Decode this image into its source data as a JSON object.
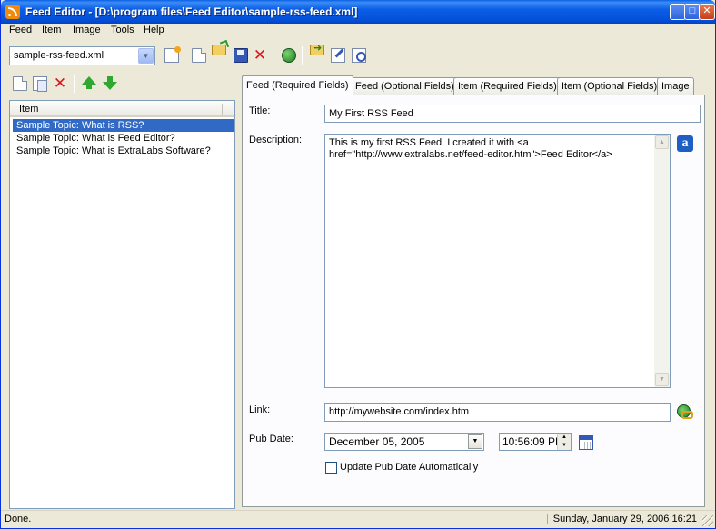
{
  "window": {
    "title": "Feed Editor - [D:\\program files\\Feed Editor\\sample-rss-feed.xml]",
    "minimize": "_",
    "maximize": "□",
    "close": "✕"
  },
  "menu": [
    "Feed",
    "Item",
    "Image",
    "Tools",
    "Help"
  ],
  "toolbar": {
    "feed_file": "sample-rss-feed.xml",
    "icons": [
      "new-feed-icon",
      "new-doc-icon",
      "open-icon",
      "save-icon",
      "delete-icon",
      "publish-icon",
      "export-icon",
      "edit-icon",
      "preview-icon"
    ]
  },
  "items_panel": {
    "column_header": "Item",
    "items": [
      "Sample Topic: What is RSS?",
      "Sample Topic: What is Feed Editor?",
      "Sample Topic: What is ExtraLabs Software?"
    ],
    "selected_index": 0
  },
  "tabs": [
    "Feed (Required Fields)",
    "Feed (Optional Fields)",
    "Item (Required Fields)",
    "Item (Optional Fields)",
    "Image"
  ],
  "active_tab": 0,
  "form": {
    "title_label": "Title:",
    "title_value": "My First RSS Feed",
    "description_label": "Description:",
    "description_value": "This is my first RSS Feed. I created it with <a href=\"http://www.extralabs.net/feed-editor.htm\">Feed Editor</a>",
    "link_label": "Link:",
    "link_value": "http://mywebsite.com/index.htm",
    "pubdate_label": "Pub Date:",
    "pubdate_date": "December 05, 2005",
    "pubdate_time": "10:56:09 PM",
    "auto_update_label": "Update Pub Date Automatically",
    "auto_update_checked": false
  },
  "status": {
    "left": "Done.",
    "right": "Sunday, January 29, 2006 16:21"
  },
  "colors": {
    "titlebar": "#0b5ee6",
    "selection": "#316ac5",
    "tab_highlight": "#e68b2c"
  }
}
